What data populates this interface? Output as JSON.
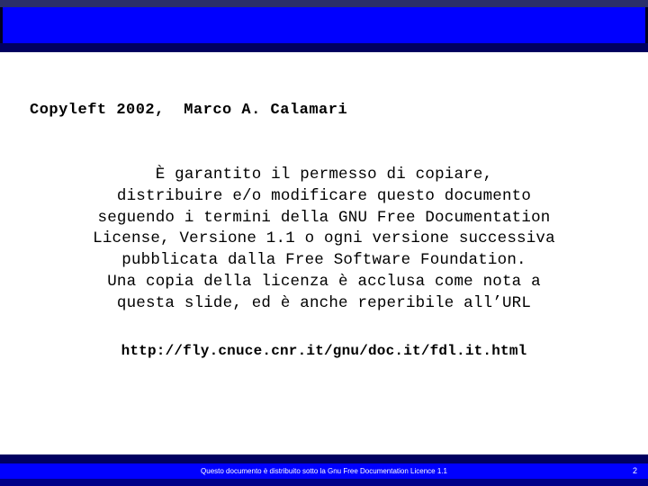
{
  "slide": {
    "title": "Copyleft 2002,  Marco A. Calamari",
    "body_lines": [
      "È garantito il permesso di copiare,",
      "distribuire e/o modificare questo documento",
      "seguendo i termini della GNU Free Documentation",
      "License, Versione 1.1 o ogni versione successiva",
      "pubblicata dalla Free Software Foundation.",
      "Una copia della licenza è acclusa come nota a",
      "questa slide, ed è anche reperibile all’URL"
    ],
    "url": "http://fly.cnuce.cnr.it/gnu/doc.it/fdl.it.html"
  },
  "footer": {
    "notice": "Questo documento è distribuito sotto la Gnu Free Documentation Licence 1.1",
    "page_number": "2"
  },
  "colors": {
    "banner_blue": "#0000ff",
    "banner_navy_dark": "#000060",
    "banner_navy_top": "#2b2f6b",
    "footer_navy_bottom": "#000088",
    "text": "#000000",
    "footer_text": "#ffffff"
  }
}
